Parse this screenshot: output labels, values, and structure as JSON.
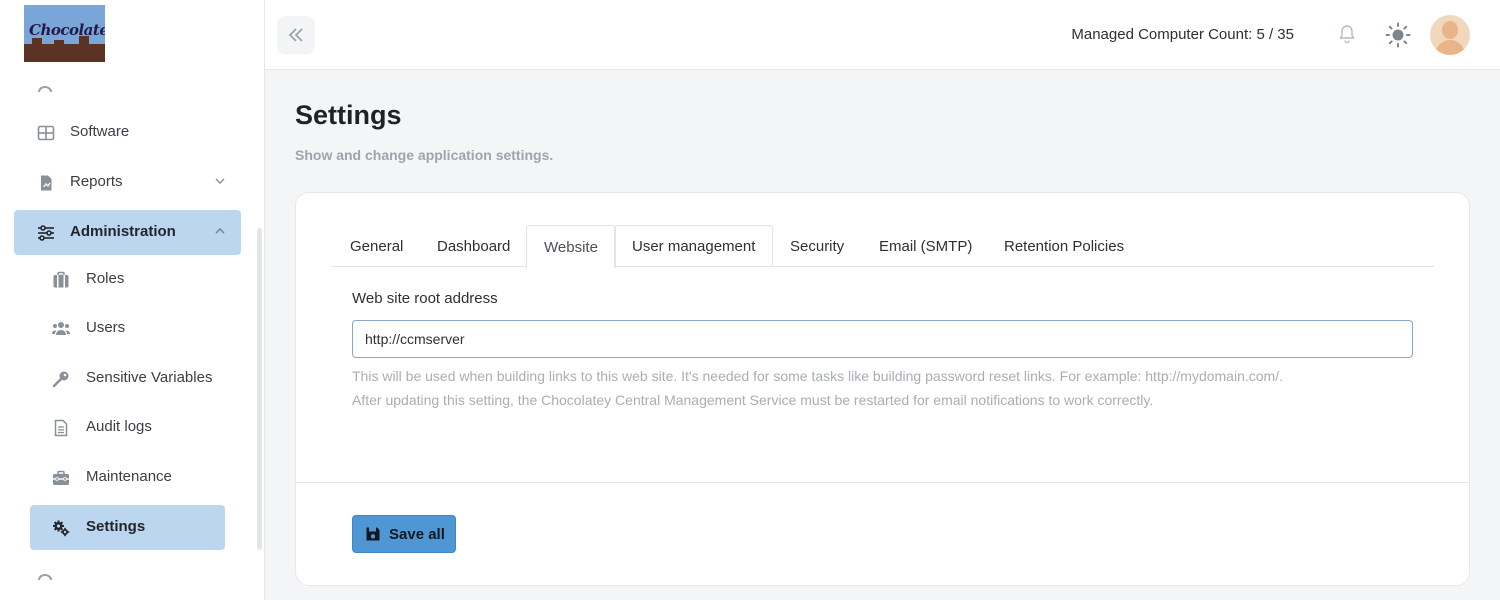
{
  "app": {
    "logo_text": "Chocolatey"
  },
  "sidebar": {
    "items": [
      {
        "label": "Software",
        "icon": "grid-icon"
      },
      {
        "label": "Reports",
        "icon": "report-icon"
      },
      {
        "label": "Administration",
        "icon": "sliders-icon",
        "expanded": true
      }
    ],
    "subitems": [
      {
        "label": "Roles",
        "icon": "briefcase-icon"
      },
      {
        "label": "Users",
        "icon": "users-icon"
      },
      {
        "label": "Sensitive Variables",
        "icon": "key-icon"
      },
      {
        "label": "Audit logs",
        "icon": "document-icon"
      },
      {
        "label": "Maintenance",
        "icon": "toolbox-icon"
      },
      {
        "label": "Settings",
        "icon": "gears-icon",
        "active": true
      }
    ]
  },
  "header": {
    "computer_count_label": "Managed Computer Count: 5 / 35",
    "icons": [
      "collapse-icon",
      "bell-icon",
      "sun-icon",
      "avatar"
    ]
  },
  "page": {
    "title": "Settings",
    "subtitle": "Show and change application settings."
  },
  "tabs": [
    {
      "label": "General"
    },
    {
      "label": "Dashboard"
    },
    {
      "label": "Website",
      "active": true
    },
    {
      "label": "User management"
    },
    {
      "label": "Security"
    },
    {
      "label": "Email (SMTP)"
    },
    {
      "label": "Retention Policies"
    }
  ],
  "form": {
    "root_address_label": "Web site root address",
    "root_address_value": "http://ccmserver",
    "help_line1": "This will be used when building links to this web site. It's needed for some tasks like building password reset links. For example: http://mydomain.com/.",
    "help_line2": "After updating this setting, the Chocolatey Central Management Service must be restarted for email notifications to work correctly."
  },
  "actions": {
    "save_label": "Save all"
  },
  "colors": {
    "accent": "#4f97d4",
    "active_nav": "#bcd6ef",
    "page_bg": "#f4f5f7"
  }
}
